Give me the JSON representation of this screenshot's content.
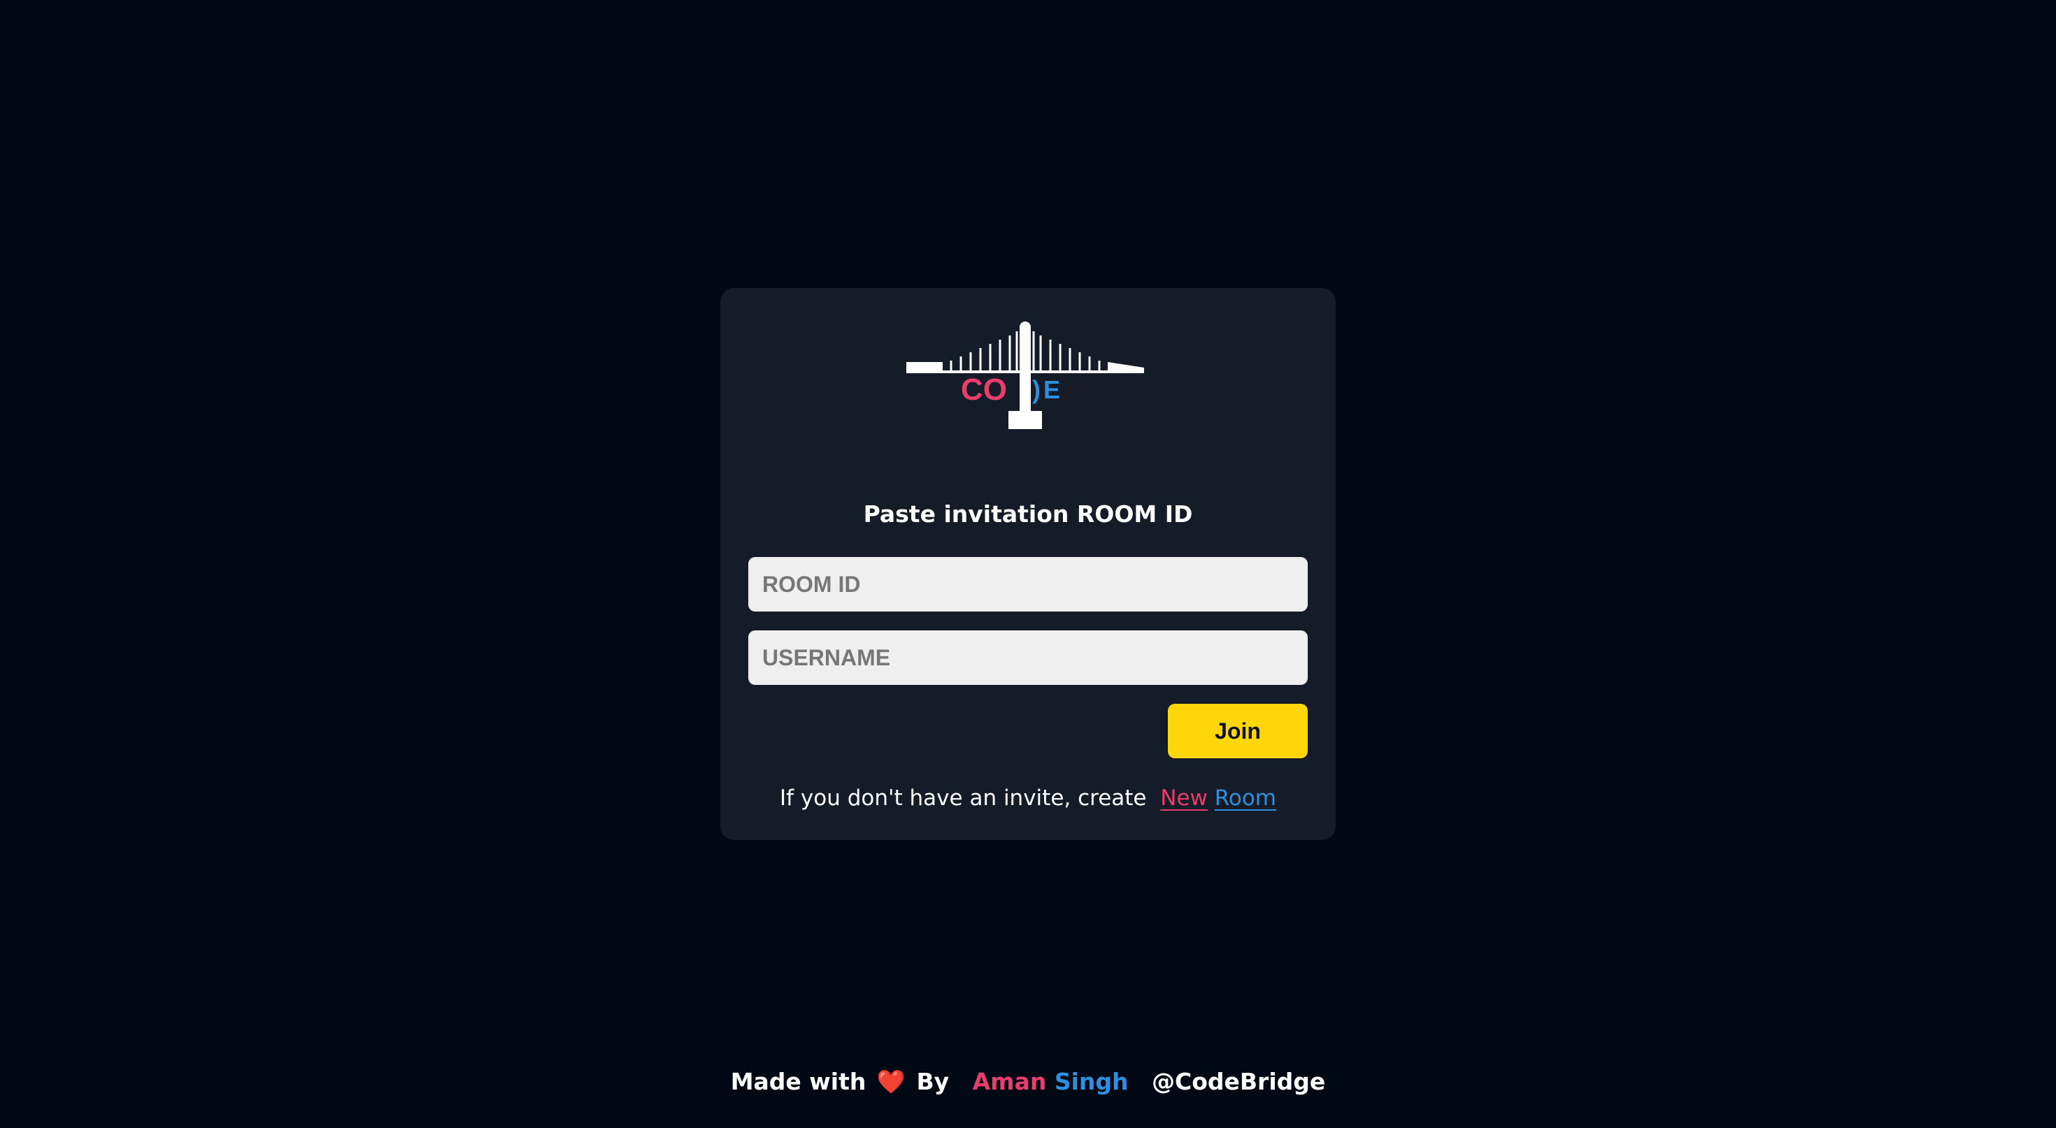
{
  "logo": {
    "text_left": "CO",
    "text_right": "E",
    "colors": {
      "pink": "#e83e6c",
      "blue": "#2e8fde",
      "white": "#ffffff"
    }
  },
  "form": {
    "heading": "Paste invitation ROOM ID",
    "room_id_placeholder": "ROOM ID",
    "room_id_value": "",
    "username_placeholder": "USERNAME",
    "username_value": "",
    "join_label": "Join",
    "join_color": "#ffd60a"
  },
  "invite": {
    "text": "If you don't have an invite, create",
    "link_word1": "New",
    "link_word2": "Room"
  },
  "footer": {
    "made_with": "Made with",
    "heart": "❤️",
    "by": "By",
    "author_first": "Aman",
    "author_last": "Singh",
    "handle": "@CodeBridge"
  },
  "colors": {
    "background": "#020914",
    "card": "#161c27",
    "accent_pink": "#e83e6c",
    "accent_blue": "#2e8fde"
  }
}
